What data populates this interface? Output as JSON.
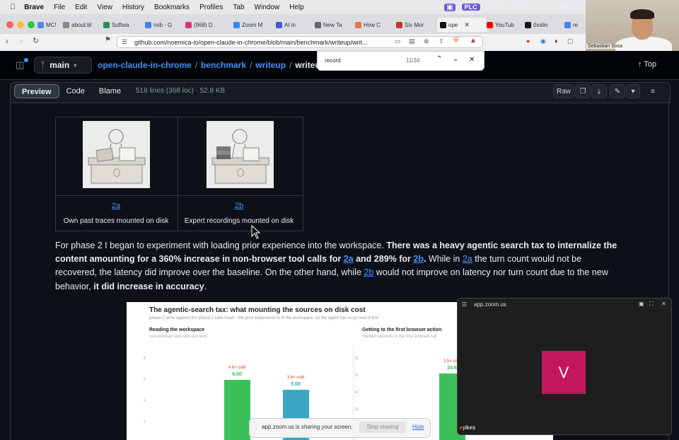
{
  "menubar": {
    "apple": "",
    "app": "Brave",
    "items": [
      "File",
      "Edit",
      "View",
      "History",
      "Bookmarks",
      "Profiles",
      "Tab",
      "Window",
      "Help"
    ],
    "plc": "PLC"
  },
  "tabs": [
    {
      "label": "MC!",
      "color": "#4a90e2"
    },
    {
      "label": "about:bl",
      "color": "#888"
    },
    {
      "label": "Softwa",
      "color": "#2e8b57"
    },
    {
      "label": "mib - G",
      "color": "#4285f4"
    },
    {
      "label": "(968) D",
      "color": "#e1306c"
    },
    {
      "label": "Zoom M",
      "color": "#2d8cff"
    },
    {
      "label": "AI in",
      "color": "#3b5bdb"
    },
    {
      "label": "New Ta",
      "color": "#666"
    },
    {
      "label": "How C",
      "color": "#e8734a"
    },
    {
      "label": "Six Mor",
      "color": "#c0392b"
    },
    {
      "label": "ope",
      "color": "#111"
    },
    {
      "label": "YouTub",
      "color": "#ff0000"
    },
    {
      "label": "0xslin",
      "color": "#111"
    },
    {
      "label": "re",
      "color": "#4285f4"
    }
  ],
  "address": {
    "url": "github.com/noemica-io/open-claude-in-chrome/blob/main/benchmark/writeup/writ..."
  },
  "webcam": {
    "name": "Sebastian Sosa"
  },
  "github": {
    "branch": "main",
    "crumbs": [
      "open-claude-in-chrome",
      "benchmark",
      "writeup"
    ],
    "current": "writeup",
    "top": "Top",
    "view_tabs": [
      "Preview",
      "Code",
      "Blame"
    ],
    "file_info": "518 lines (368 loc) · 52.8 KB",
    "raw": "Raw"
  },
  "find": {
    "query": "record",
    "count": "11/34"
  },
  "figures": [
    {
      "link": "2a",
      "caption": "Own past traces mounted on disk"
    },
    {
      "link": "2b",
      "caption": "Expert recordings mounted on disk"
    }
  ],
  "paragraph": {
    "p1": "For phase 2 I began to experiment with loading prior experience into the workspace. ",
    "b1": "There was a heavy agentic search tax to internalize the content amounting for a 360% increase in non-browser tool calls for ",
    "l1": "2a",
    "b2": " and 289% for ",
    "l2": "2b",
    "b3": ".",
    "p2": " While in ",
    "l3": "2a",
    "p3": " the turn count would not be recovered, the latency did improve over the baseline. On the other hand, while ",
    "l4": "2b",
    "p4": " would not improve on latency nor turn count due to the new behavior, ",
    "b4": "it did increase in accuracy",
    "p5": "."
  },
  "chart_data": {
    "type": "bar",
    "title": "The agentic-search tax: what mounting the sources on disk cost",
    "subtitle": "phase-2 arms against the phase-1 cold mean · the prior experience is in the workspace, so the agent has to go read it first",
    "panels": [
      {
        "title": "Reading the workspace",
        "subtitle": "non-browser tool calls per task",
        "yticks": [
          "8",
          "6",
          "4",
          "2"
        ],
        "bars": [
          {
            "label": "4.6× cold",
            "value": "6.00",
            "color": "#3cc15a"
          },
          {
            "label": "3.9× cold",
            "value": "5.08",
            "color": "#3ba6c4"
          }
        ]
      },
      {
        "title": "Getting to the first browser action",
        "subtitle": "median seconds to the first browser call",
        "yticks": [
          "25",
          "20",
          "15",
          "10",
          "5"
        ],
        "bars": [
          {
            "label": "3.5× cold",
            "value": "20.6",
            "color": "#3cc15a"
          }
        ]
      }
    ]
  },
  "zoom": {
    "title": "app.zoom.us",
    "avatar": "V",
    "participant": "yikes"
  },
  "share": {
    "text": "app.zoom.us is sharing your screen.",
    "stop": "Stop sharing",
    "hide": "Hide"
  }
}
